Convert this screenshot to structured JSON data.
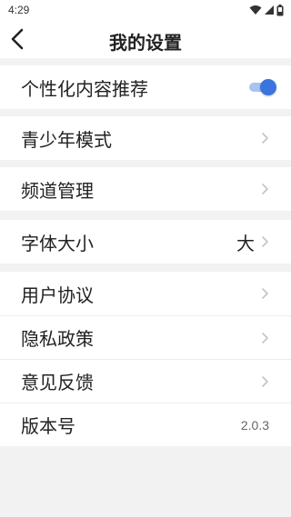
{
  "status_bar": {
    "time": "4:29"
  },
  "header": {
    "title": "我的设置"
  },
  "groups": [
    {
      "items": [
        {
          "label": "个性化内容推荐",
          "toggle": true
        }
      ]
    },
    {
      "items": [
        {
          "label": "青少年模式"
        }
      ]
    },
    {
      "items": [
        {
          "label": "频道管理"
        }
      ]
    },
    {
      "items": [
        {
          "label": "字体大小",
          "value": "大"
        }
      ]
    },
    {
      "items": [
        {
          "label": "用户协议"
        },
        {
          "label": "隐私政策"
        },
        {
          "label": "意见反馈"
        },
        {
          "label": "版本号",
          "value": "2.0.3"
        }
      ]
    }
  ],
  "colors": {
    "accent": "#3b74de",
    "background": "#f2f2f2"
  }
}
